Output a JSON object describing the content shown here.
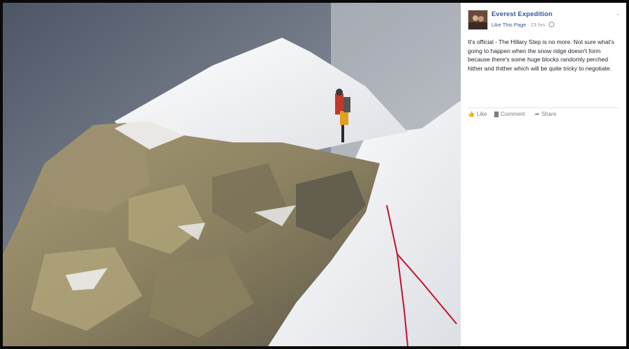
{
  "post": {
    "page_name": "Everest Expedition",
    "like_page": "Like This Page",
    "time": "23 hrs",
    "separator": "·",
    "text": "It's official - The Hillary Step is no more. Not sure what's going to happen when the snow ridge doesn't form because there's some huge blocks randomly perched hither and thither which will be quite tricky to negotiate.",
    "actions": {
      "like": "Like",
      "comment": "Comment",
      "share": "Share"
    }
  },
  "icons": {
    "globe": "globe-icon",
    "chevron": "chevron-down-icon",
    "like": "thumbs-up-icon",
    "comment": "comment-bubble-icon",
    "share": "share-arrow-icon"
  },
  "colors": {
    "link": "#365899",
    "meta": "#90949c",
    "text": "#1d2129",
    "rope": "#c8102e"
  }
}
